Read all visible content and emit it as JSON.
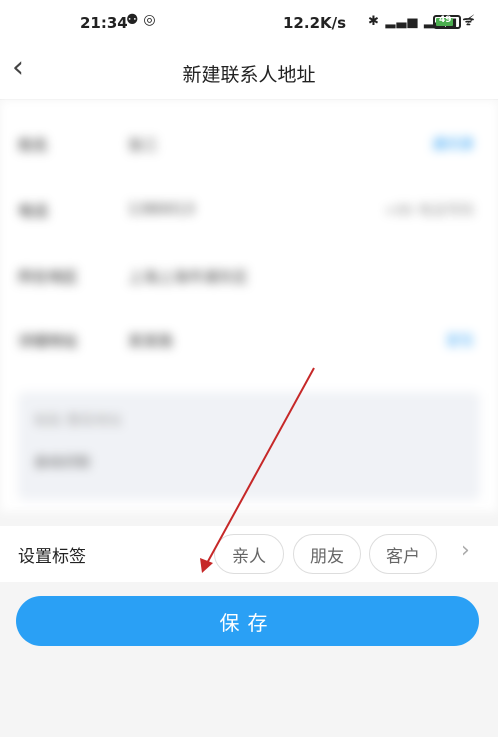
{
  "status_bar": {
    "time": "21:34",
    "status_icons": "⚉ ◎",
    "network_speed": "12.2K/s",
    "radio_icons": "✱ ▂▃▅ ▂▃▅ ᯤ",
    "battery": "49",
    "charging": "⚡"
  },
  "nav": {
    "back_glyph": "‹",
    "title": "新建联系人地址"
  },
  "form": {
    "rows": [
      {
        "label": "姓名",
        "value": "张三",
        "side": "通讯录"
      },
      {
        "label": "电话",
        "value": "1380013",
        "side": "+86 电话号码"
      },
      {
        "label": "所在地区",
        "value": "上海上海市浦东区",
        "side": ""
      },
      {
        "label": "详细地址",
        "value": "某某路",
        "side": "定位"
      }
    ],
    "address_placeholder": "粘贴 整段地址",
    "address_link": "自动识别"
  },
  "tags": {
    "label": "设置标签",
    "options": [
      "亲人",
      "朋友",
      "客户"
    ],
    "more_glyph": "›"
  },
  "save_button": "保存",
  "colors": {
    "primary": "#2aa0f5",
    "annotation_arrow": "#c62828"
  }
}
